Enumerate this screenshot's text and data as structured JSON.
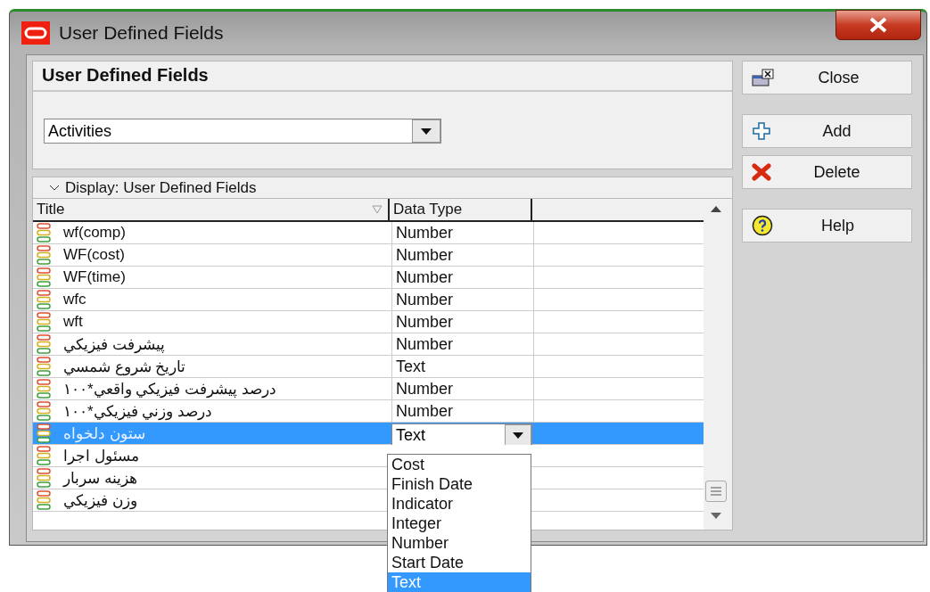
{
  "window": {
    "title": "User Defined Fields"
  },
  "panel": {
    "heading": "User Defined Fields",
    "subject": {
      "value": "Activities"
    }
  },
  "display_bar": {
    "label": "Display: User Defined Fields",
    "expanded": true
  },
  "table": {
    "columns": [
      "Title",
      "Data Type"
    ],
    "rows": [
      {
        "title": "wf(comp)",
        "data_type": "Number",
        "selected": false
      },
      {
        "title": "WF(cost)",
        "data_type": "Number",
        "selected": false
      },
      {
        "title": "WF(time)",
        "data_type": "Number",
        "selected": false
      },
      {
        "title": "wfc",
        "data_type": "Number",
        "selected": false
      },
      {
        "title": "wft",
        "data_type": "Number",
        "selected": false
      },
      {
        "title": "پيشرفت فيزيكي",
        "data_type": "Number",
        "selected": false
      },
      {
        "title": "تاريخ شروع شمسي",
        "data_type": "Text",
        "selected": false
      },
      {
        "title": "درصد پيشرفت فيزيكي واقعي*١٠٠",
        "data_type": "Number",
        "selected": false
      },
      {
        "title": "درصد وزني فيزيكي*١٠٠",
        "data_type": "Number",
        "selected": false
      },
      {
        "title": "ستون دلخواه",
        "data_type": "Text",
        "selected": true
      },
      {
        "title": "مسئول اجرا",
        "data_type": "",
        "selected": false
      },
      {
        "title": "هزينه سربار",
        "data_type": "",
        "selected": false
      },
      {
        "title": "وزن فيزيكي",
        "data_type": "",
        "selected": false
      }
    ]
  },
  "data_type_menu": {
    "open": true,
    "options": [
      {
        "label": "Cost",
        "selected": false
      },
      {
        "label": "Finish Date",
        "selected": false
      },
      {
        "label": "Indicator",
        "selected": false
      },
      {
        "label": "Integer",
        "selected": false
      },
      {
        "label": "Number",
        "selected": false
      },
      {
        "label": "Start Date",
        "selected": false
      },
      {
        "label": "Text",
        "selected": true
      }
    ]
  },
  "buttons": [
    {
      "label": "Close",
      "kind": "close"
    },
    {
      "label": "Add",
      "kind": "add"
    },
    {
      "label": "Delete",
      "kind": "delete"
    },
    {
      "label": "Help",
      "kind": "help"
    }
  ]
}
